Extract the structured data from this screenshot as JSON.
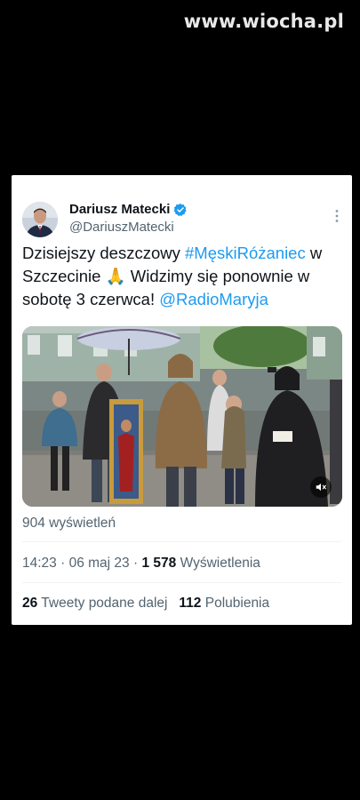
{
  "watermark": "www.wiocha.pl",
  "tweet": {
    "author": {
      "name": "Dariusz Matecki",
      "handle": "@DariuszMatecki",
      "verified": true
    },
    "text": {
      "part1": "Dzisiejszy deszczowy ",
      "hashtag": "#MęskiRóżaniec",
      "part2": " w Szczecinie ",
      "emoji": "🙏",
      "part3": "  Widzimy się ponownie w sobotę 3 czerwca! ",
      "mention": "@RadioMaryja"
    },
    "video_views": "904 wyświetleń",
    "time": "14:23",
    "date": "06 maj 23",
    "sep": "·",
    "views_count": "1 578",
    "views_label": "Wyświetlenia",
    "retweets_count": "26",
    "retweets_label": "Tweety podane dalej",
    "likes_count": "112",
    "likes_label": "Polubienia"
  },
  "colors": {
    "link": "#1d9bf0",
    "text": "#0f1419",
    "muted": "#536471",
    "verified": "#1d9bf0"
  },
  "icons": {
    "verified": "verified-badge-icon",
    "more": "more-options-icon",
    "mute": "speaker-muted-icon"
  }
}
